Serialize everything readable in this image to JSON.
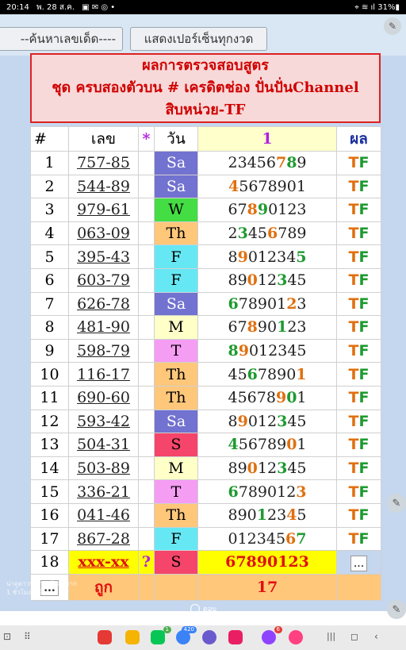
{
  "status": {
    "time": "20:14",
    "date": "พ. 28 ส.ค.",
    "icons": "▣ ✉ ◎ •",
    "right": "⌖ ≋ ıl 31%▮"
  },
  "toolbar": {
    "search_label": "--ค้นหาเลขเด็ด----",
    "percent_label": "แสดงเปอร์เซ็นทุกงวด",
    "pen_icon": "pen-icon"
  },
  "title": {
    "line1": "ผลการตรวจสอบสูตร",
    "line2": "ชุด ครบสองตัวบน # เครดิตช่อง ปั่นปั่นChannel",
    "line3": "สิบหน่วย-TF"
  },
  "table": {
    "headers": [
      "#",
      "เลข",
      "*",
      "วัน",
      "1",
      "ผล"
    ],
    "rows": [
      {
        "n": "1",
        "code": "757-85",
        "day": "Sa",
        "seq": "23456789",
        "hl": {
          "5": "o",
          "6": "g"
        },
        "res": "TF"
      },
      {
        "n": "2",
        "code": "544-89",
        "day": "Sa",
        "seq": "45678901",
        "hl": {
          "0": "o"
        },
        "res": "TF"
      },
      {
        "n": "3",
        "code": "979-61",
        "day": "W",
        "seq": "67890123",
        "hl": {
          "2": "o",
          "3": "g"
        },
        "res": "TF"
      },
      {
        "n": "4",
        "code": "063-09",
        "day": "Th",
        "seq": "23456789",
        "hl": {
          "1": "g",
          "4": "o"
        },
        "res": "TF"
      },
      {
        "n": "5",
        "code": "395-43",
        "day": "F",
        "seq": "89012345",
        "hl": {
          "1": "o",
          "7": "g"
        },
        "res": "TF"
      },
      {
        "n": "6",
        "code": "603-79",
        "day": "F",
        "seq": "89012345",
        "hl": {
          "2": "o",
          "5": "g"
        },
        "res": "TF"
      },
      {
        "n": "7",
        "code": "626-78",
        "day": "Sa",
        "seq": "67890123",
        "hl": {
          "0": "g",
          "6": "o"
        },
        "res": "TF"
      },
      {
        "n": "8",
        "code": "481-90",
        "day": "M",
        "seq": "67890123",
        "hl": {
          "2": "o",
          "5": "g"
        },
        "res": "TF"
      },
      {
        "n": "9",
        "code": "598-79",
        "day": "T",
        "seq": "89012345",
        "hl": {
          "0": "g",
          "1": "o"
        },
        "res": "TF"
      },
      {
        "n": "10",
        "code": "116-17",
        "day": "Th",
        "seq": "45678901",
        "hl": {
          "2": "g",
          "7": "o"
        },
        "res": "TF"
      },
      {
        "n": "11",
        "code": "690-60",
        "day": "Th",
        "seq": "45678901",
        "hl": {
          "5": "o",
          "6": "g"
        },
        "res": "TF"
      },
      {
        "n": "12",
        "code": "593-42",
        "day": "Sa",
        "seq": "89012345",
        "hl": {
          "1": "o",
          "5": "g"
        },
        "res": "TF"
      },
      {
        "n": "13",
        "code": "504-31",
        "day": "S",
        "seq": "45678901",
        "hl": {
          "0": "g",
          "6": "o"
        },
        "res": "TF"
      },
      {
        "n": "14",
        "code": "503-89",
        "day": "M",
        "seq": "89012345",
        "hl": {
          "2": "o",
          "5": "g"
        },
        "res": "TF"
      },
      {
        "n": "15",
        "code": "336-21",
        "day": "T",
        "seq": "67890123",
        "hl": {
          "0": "g",
          "7": "o"
        },
        "res": "TF"
      },
      {
        "n": "16",
        "code": "041-46",
        "day": "Th",
        "seq": "89012345",
        "hl": {
          "3": "g",
          "6": "o"
        },
        "res": "TF"
      },
      {
        "n": "17",
        "code": "867-28",
        "day": "F",
        "seq": "01234567",
        "hl": {
          "6": "o",
          "7": "g"
        },
        "res": "TF"
      }
    ],
    "last": {
      "n": "18",
      "code": "xxx-xx",
      "mark": "?",
      "day": "S",
      "seq": "67890123",
      "res": "..."
    },
    "footer": {
      "more": "...",
      "label": "ถูก",
      "count": "17"
    }
  },
  "overlay": {
    "line1": "น่าดูดาวที่ ผ่านเข้ามามาก",
    "line2": "1 ชั่วโมงที่แล้ว"
  },
  "comment": {
    "label": "ตอบ"
  },
  "navbar": {
    "apps": [
      "flipboard",
      "notes",
      "line",
      "messages",
      "samsung-internet",
      "screen-recorder",
      "messenger",
      "blossom"
    ],
    "badges": {
      "line": "1",
      "messages": "420",
      "messenger": "6"
    }
  }
}
